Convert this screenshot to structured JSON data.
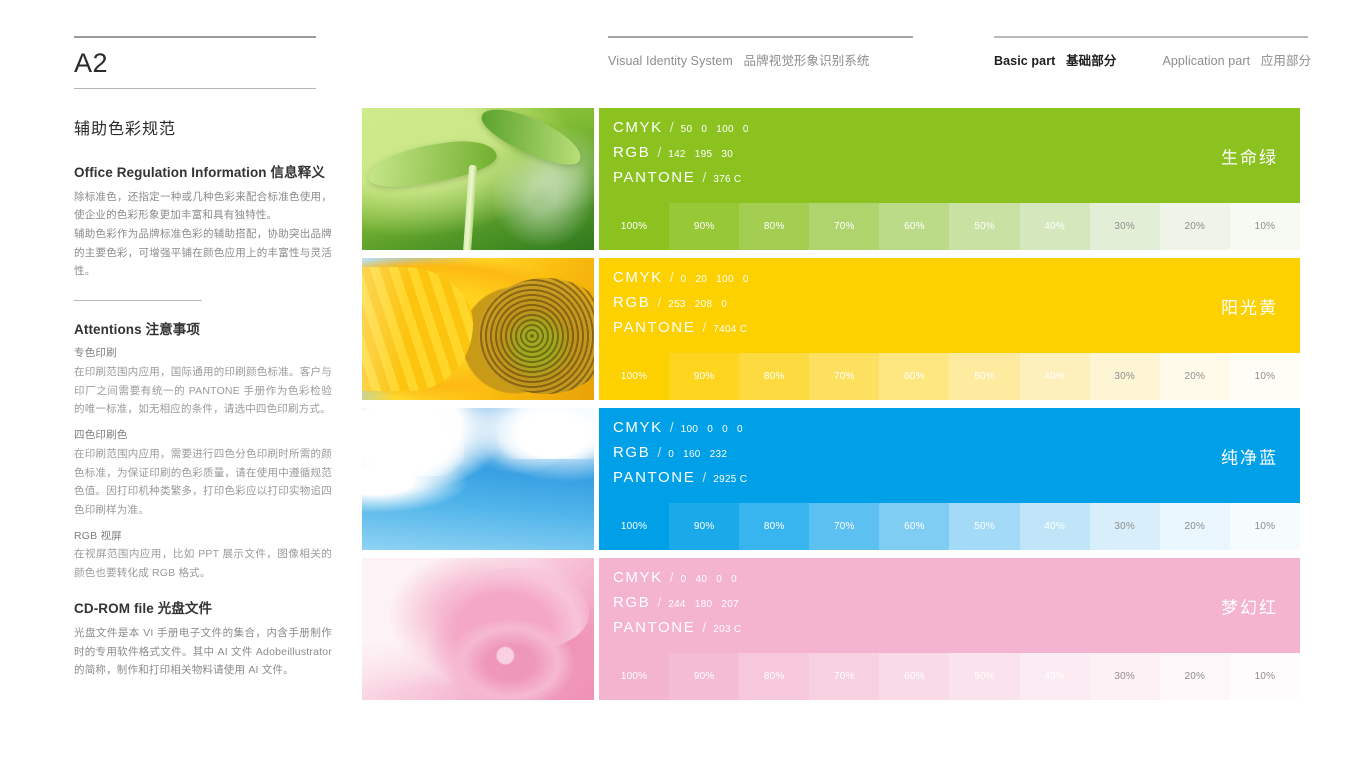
{
  "sidebar": {
    "code": "A2",
    "section_title": "辅助色彩规范",
    "info": {
      "heading_en": "Office Regulation Information",
      "heading_zh": "信息释义",
      "paragraph1": "除标准色，还指定一种或几种色彩来配合标准色使用，使企业的色彩形象更加丰富和具有独特性。",
      "paragraph2": "辅助色彩作为品牌标准色彩的辅助搭配，协助突出品牌的主要色彩，可增强平铺在颜色应用上的丰富性与灵活性。"
    },
    "attentions": {
      "heading_en": "Attentions",
      "heading_zh": "注意事项",
      "items": [
        {
          "label": "专色印刷",
          "text": "在印刷范围内应用，国际通用的印刷颜色标准。客户与印厂之间需要有统一的 PANTONE 手册作为色彩检验的唯一标准，如无相应的条件，请选中四色印刷方式。"
        },
        {
          "label": "四色印刷色",
          "text": "在印刷范围内应用，需要进行四色分色印刷时所需的颜色标准，为保证印刷的色彩质量，请在使用中遵循规范色值。因打印机种类繁多，打印色彩应以打印实物追四色印刷样为准。"
        },
        {
          "label": "RGB 视屏",
          "text": "在视屏范围内应用，比如 PPT 展示文件，图像相关的颜色也要转化成 RGB 格式。"
        }
      ]
    },
    "cdrom": {
      "heading_en": "CD-ROM file",
      "heading_zh": "光盘文件",
      "text": "光盘文件是本 VI 手册电子文件的集合，内含手册制作时的专用软件格式文件。其中 AI 文件 Adobeillustrator 的简称，制作和打印相关物料请使用 AI 文件。"
    }
  },
  "topnav": {
    "left": [
      {
        "en": "Visual Identity System",
        "zh": "品牌视觉形象识别系统",
        "active": false
      }
    ],
    "right": [
      {
        "en": "Basic part",
        "zh": "基础部分",
        "active": true
      },
      {
        "en": "Application part",
        "zh": "应用部分",
        "active": false
      }
    ]
  },
  "labels": {
    "cmyk": "CMYK",
    "rgb": "RGB",
    "pantone": "PANTONE",
    "slash": "/"
  },
  "tint_steps": [
    "100%",
    "90%",
    "80%",
    "70%",
    "60%",
    "50%",
    "40%",
    "30%",
    "20%",
    "10%"
  ],
  "colors": [
    {
      "name_zh": "生命绿",
      "image": "green-leaf-photo",
      "hex": "#8cc220",
      "cmyk": [
        "50",
        "0",
        "100",
        "0"
      ],
      "rgb": [
        "142",
        "195",
        "30"
      ],
      "pantone": "376 C",
      "tints": [
        "#8cc220",
        "#97c836",
        "#a3ce52",
        "#b0d46d",
        "#bcdb88",
        "#c9e1a3",
        "#d5e7bd",
        "#e2eed6",
        "#eef4e8",
        "#f7faf3"
      ]
    },
    {
      "name_zh": "阳光黄",
      "image": "sunflower-photo",
      "hex": "#fdd000",
      "cmyk": [
        "0",
        "20",
        "100",
        "0"
      ],
      "rgb": [
        "253",
        "208",
        "0"
      ],
      "pantone": "7404 C",
      "tints": [
        "#fdd000",
        "#fdd51f",
        "#fddb40",
        "#fde060",
        "#fee681",
        "#feeba0",
        "#fef0bc",
        "#fef5d5",
        "#fffaea",
        "#fffdf6"
      ]
    },
    {
      "name_zh": "纯净蓝",
      "image": "blue-sky-clouds-photo",
      "hex": "#00a0e8",
      "cmyk": [
        "100",
        "0",
        "0",
        "0"
      ],
      "rgb": [
        "0",
        "160",
        "232"
      ],
      "pantone": "2925 C",
      "tints": [
        "#00a0e8",
        "#1aaaea",
        "#38b5ee",
        "#5cc1f1",
        "#80cdf4",
        "#a2daf7",
        "#c0e5f9",
        "#d8eefb",
        "#eaf6fd",
        "#f6fbfe"
      ]
    },
    {
      "name_zh": "梦幻红",
      "image": "pink-rose-photo",
      "hex": "#f4b4cf",
      "cmyk": [
        "0",
        "40",
        "0",
        "0"
      ],
      "rgb": [
        "244",
        "180",
        "207"
      ],
      "pantone": "203 C",
      "tints": [
        "#f4b4cf",
        "#f5bdd5",
        "#f7c7db",
        "#f8d1e1",
        "#f9dbe7",
        "#fae3ed",
        "#fcebf2",
        "#fdf1f6",
        "#fef7fa",
        "#fffcfd"
      ]
    }
  ]
}
